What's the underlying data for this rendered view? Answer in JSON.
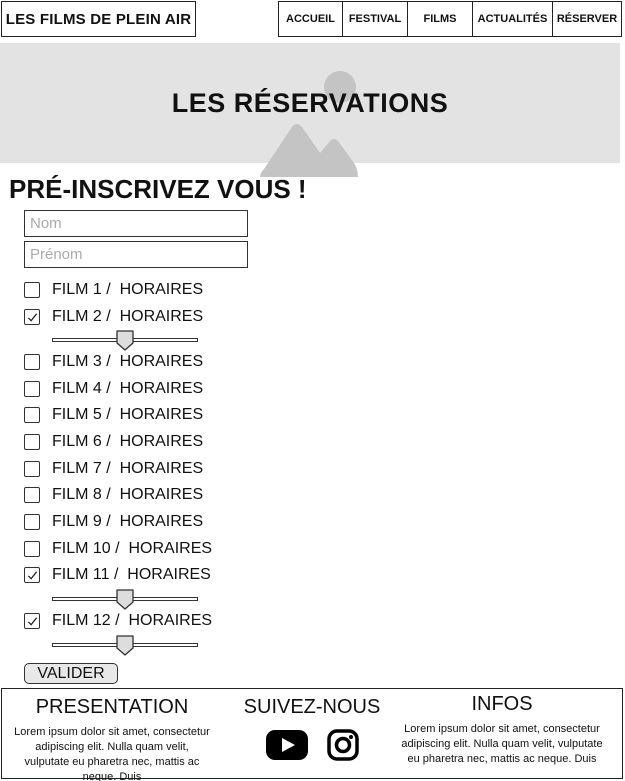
{
  "header": {
    "logo": "LES FILMS DE PLEIN AIR",
    "nav": [
      {
        "label": "ACCUEIL"
      },
      {
        "label": "FESTIVAL"
      },
      {
        "label": "FILMS"
      },
      {
        "label": "ACTUALITÉS"
      },
      {
        "label": "RÉSERVER"
      }
    ]
  },
  "hero": {
    "title": "LES RÉSERVATIONS",
    "icon": "image-placeholder-icon"
  },
  "form": {
    "title": "PRÉ-INSCRIVEZ VOUS !",
    "last_name_placeholder": "Nom",
    "first_name_placeholder": "Prénom",
    "films": [
      {
        "label": "FILM 1 /  HORAIRES",
        "checked": false
      },
      {
        "label": "FILM 2 /  HORAIRES",
        "checked": true,
        "slider": 0.5
      },
      {
        "label": "FILM 3 /  HORAIRES",
        "checked": false
      },
      {
        "label": "FILM 4 /  HORAIRES",
        "checked": false
      },
      {
        "label": "FILM 5 /  HORAIRES",
        "checked": false
      },
      {
        "label": "FILM 6 /  HORAIRES",
        "checked": false
      },
      {
        "label": "FILM 7 /  HORAIRES",
        "checked": false
      },
      {
        "label": "FILM 8 /  HORAIRES",
        "checked": false
      },
      {
        "label": "FILM 9 /  HORAIRES",
        "checked": false
      },
      {
        "label": "FILM 10 /  HORAIRES",
        "checked": false
      },
      {
        "label": "FILM 11 /  HORAIRES",
        "checked": true,
        "slider": 0.5
      },
      {
        "label": "FILM 12 /  HORAIRES",
        "checked": true,
        "slider": 0.5
      }
    ],
    "submit_label": "VALIDER"
  },
  "footer": {
    "presentation": {
      "heading": "PRESENTATION",
      "text": "Lorem ipsum dolor sit amet, consectetur adipiscing elit. Nulla quam velit, vulputate eu pharetra nec, mattis ac neque. Duis"
    },
    "follow": {
      "heading": "SUIVEZ-NOUS",
      "icons": [
        "youtube-icon",
        "instagram-icon"
      ]
    },
    "infos": {
      "heading": "INFOS",
      "text": "Lorem ipsum dolor sit amet, consectetur adipiscing elit. Nulla quam velit, vulputate eu pharetra nec, mattis ac neque. Duis"
    }
  }
}
